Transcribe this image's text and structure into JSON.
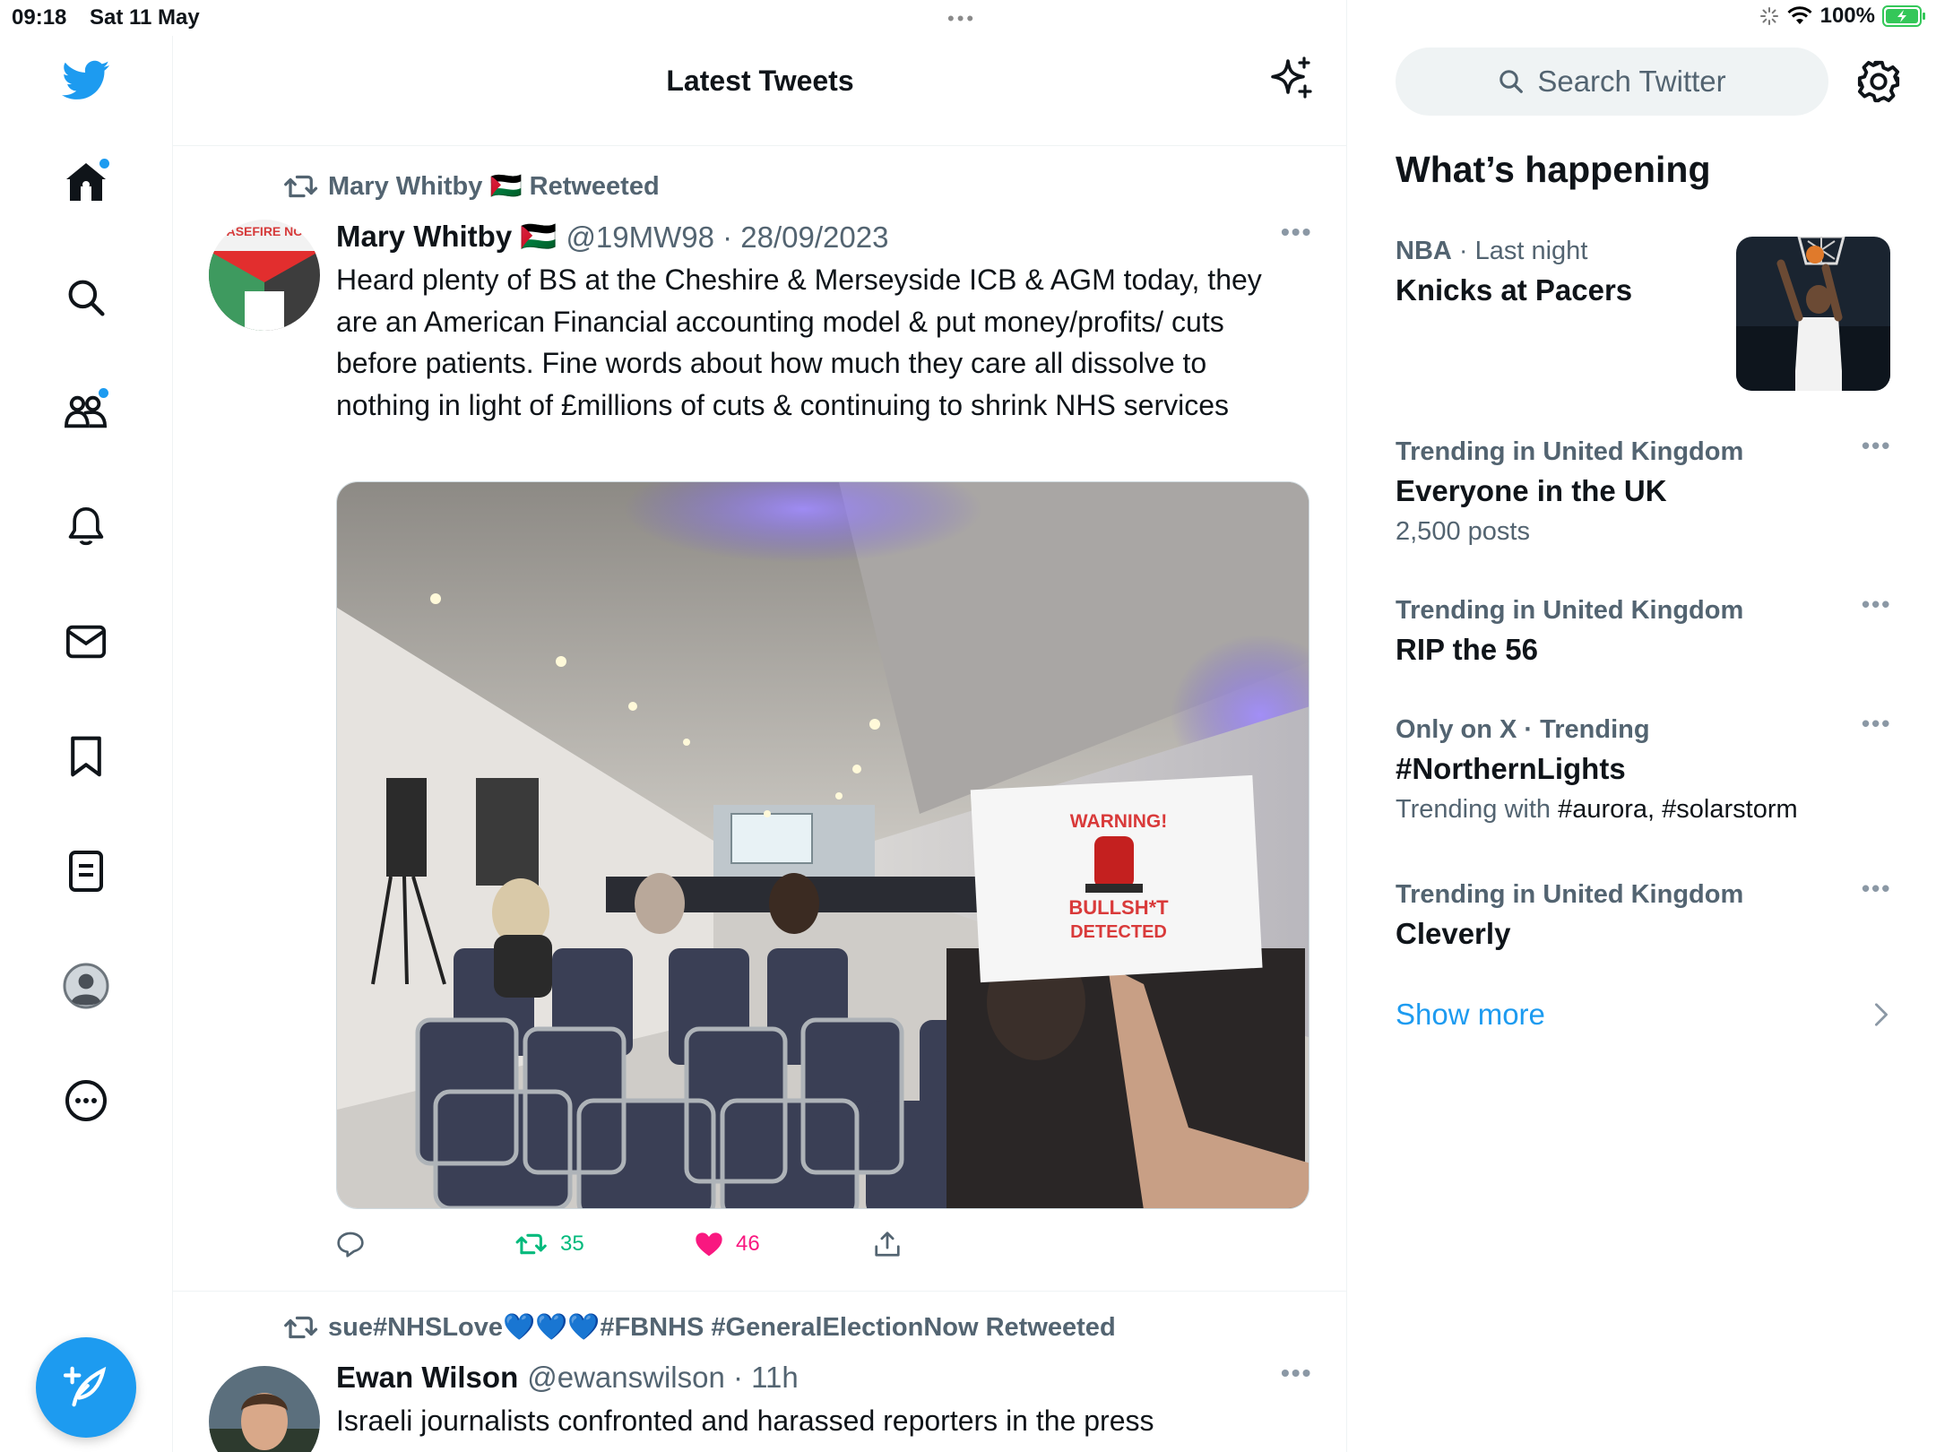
{
  "status_bar": {
    "time": "09:18",
    "date": "Sat 11 May",
    "battery": "100%"
  },
  "colors": {
    "accent": "#1d9bf0",
    "text_primary": "#0f1419",
    "text_secondary": "#536471",
    "retweet_green": "#00ba7c",
    "like_pink": "#f91880"
  },
  "nav": {
    "items": [
      {
        "name": "twitter-logo-icon"
      },
      {
        "name": "home-icon"
      },
      {
        "name": "explore-search-icon"
      },
      {
        "name": "communities-icon"
      },
      {
        "name": "notifications-bell-icon"
      },
      {
        "name": "messages-envelope-icon"
      },
      {
        "name": "bookmarks-icon"
      },
      {
        "name": "lists-icon"
      },
      {
        "name": "profile-avatar-icon"
      },
      {
        "name": "more-circle-icon"
      }
    ],
    "compose_icon": "feather-plus-icon"
  },
  "timeline": {
    "title": "Latest Tweets",
    "tweets": [
      {
        "retweeted_by": "Mary Whitby 🇵🇸 Retweeted",
        "name": "Mary Whitby 🇵🇸",
        "handle_time": "@19MW98 · 28/09/2023",
        "text": "Heard plenty of BS at the Cheshire & Merseyside ICB & AGM today, they are an American Financial accounting model & put money/profits/ cuts before patients. Fine words about how much they care all dissolve to nothing in light of £millions of cuts & continuing to shrink NHS services",
        "media_sign": {
          "line1": "WARNING!",
          "line2": "BULLSH*T",
          "line3": "DETECTED"
        },
        "retweets": "35",
        "likes": "46"
      },
      {
        "retweeted_by": "sue#NHSLove💙💙💙#FBNHS #GeneralElectionNow Retweeted",
        "name": "Ewan Wilson",
        "handle_time": "@ewanswilson · 11h",
        "text": "Israeli journalists confronted and harassed reporters in the press"
      }
    ]
  },
  "sidebar": {
    "search_placeholder": "Search Twitter",
    "section_title": "What’s happening",
    "trends": [
      {
        "context_bold": "NBA",
        "context": " · Last night",
        "title": "Knicks at Pacers"
      },
      {
        "context_bold": "Trending in United Kingdom",
        "context": "",
        "title": "Everyone in the UK",
        "sub": "2,500 posts"
      },
      {
        "context_bold": "Trending in United Kingdom",
        "context": "",
        "title": "RIP the 56"
      },
      {
        "context_bold": "Only on X · Trending",
        "context": "",
        "title": "#NorthernLights",
        "sub_prefix": "Trending with ",
        "sub_tags": "#aurora, #solarstorm"
      },
      {
        "context_bold": "Trending in United Kingdom",
        "context": "",
        "title": "Cleverly"
      }
    ],
    "show_more": "Show more"
  }
}
